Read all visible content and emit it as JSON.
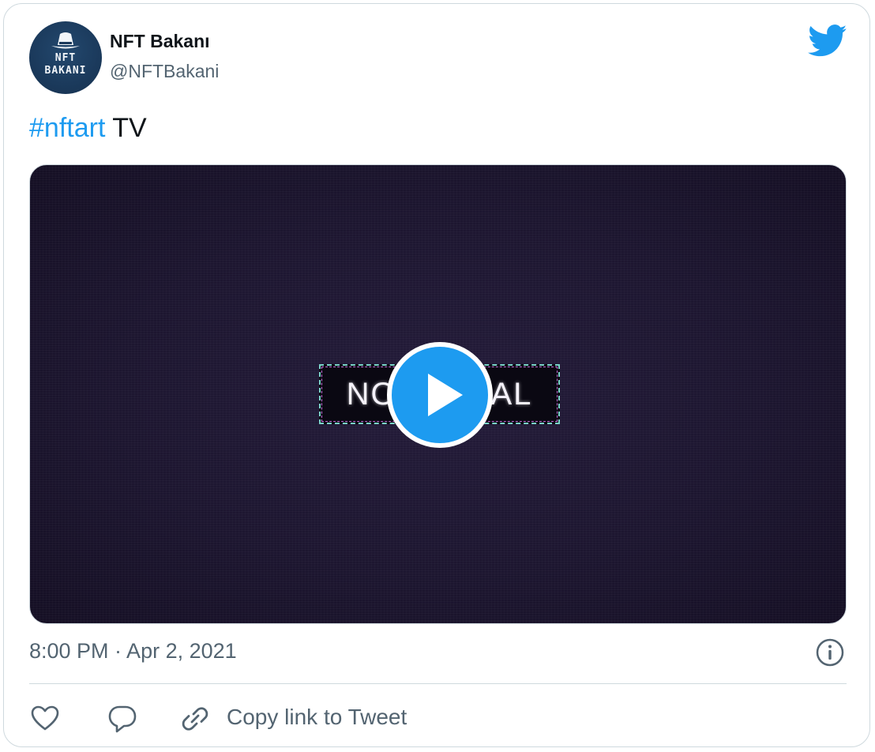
{
  "author": {
    "name": "NFT Bakanı",
    "handle": "@NFTBakani",
    "avatar_text_line1": "NFT",
    "avatar_text_line2": "BAKANI"
  },
  "tweet": {
    "hashtag": "#nftart",
    "text": " TV"
  },
  "media": {
    "overlay_text": "NO SIGNAL",
    "play_icon": "play-icon"
  },
  "timestamp": "8:00 PM · Apr 2, 2021",
  "actions": {
    "copy_link_label": "Copy link to Tweet"
  },
  "icons": {
    "logo": "twitter-bird-icon",
    "info": "info-icon",
    "like": "heart-icon",
    "reply": "speech-bubble-icon",
    "copy": "link-icon"
  },
  "colors": {
    "accent": "#1d9bf0",
    "text_primary": "#0f1419",
    "text_secondary": "#536471",
    "border": "#cfd9de"
  }
}
